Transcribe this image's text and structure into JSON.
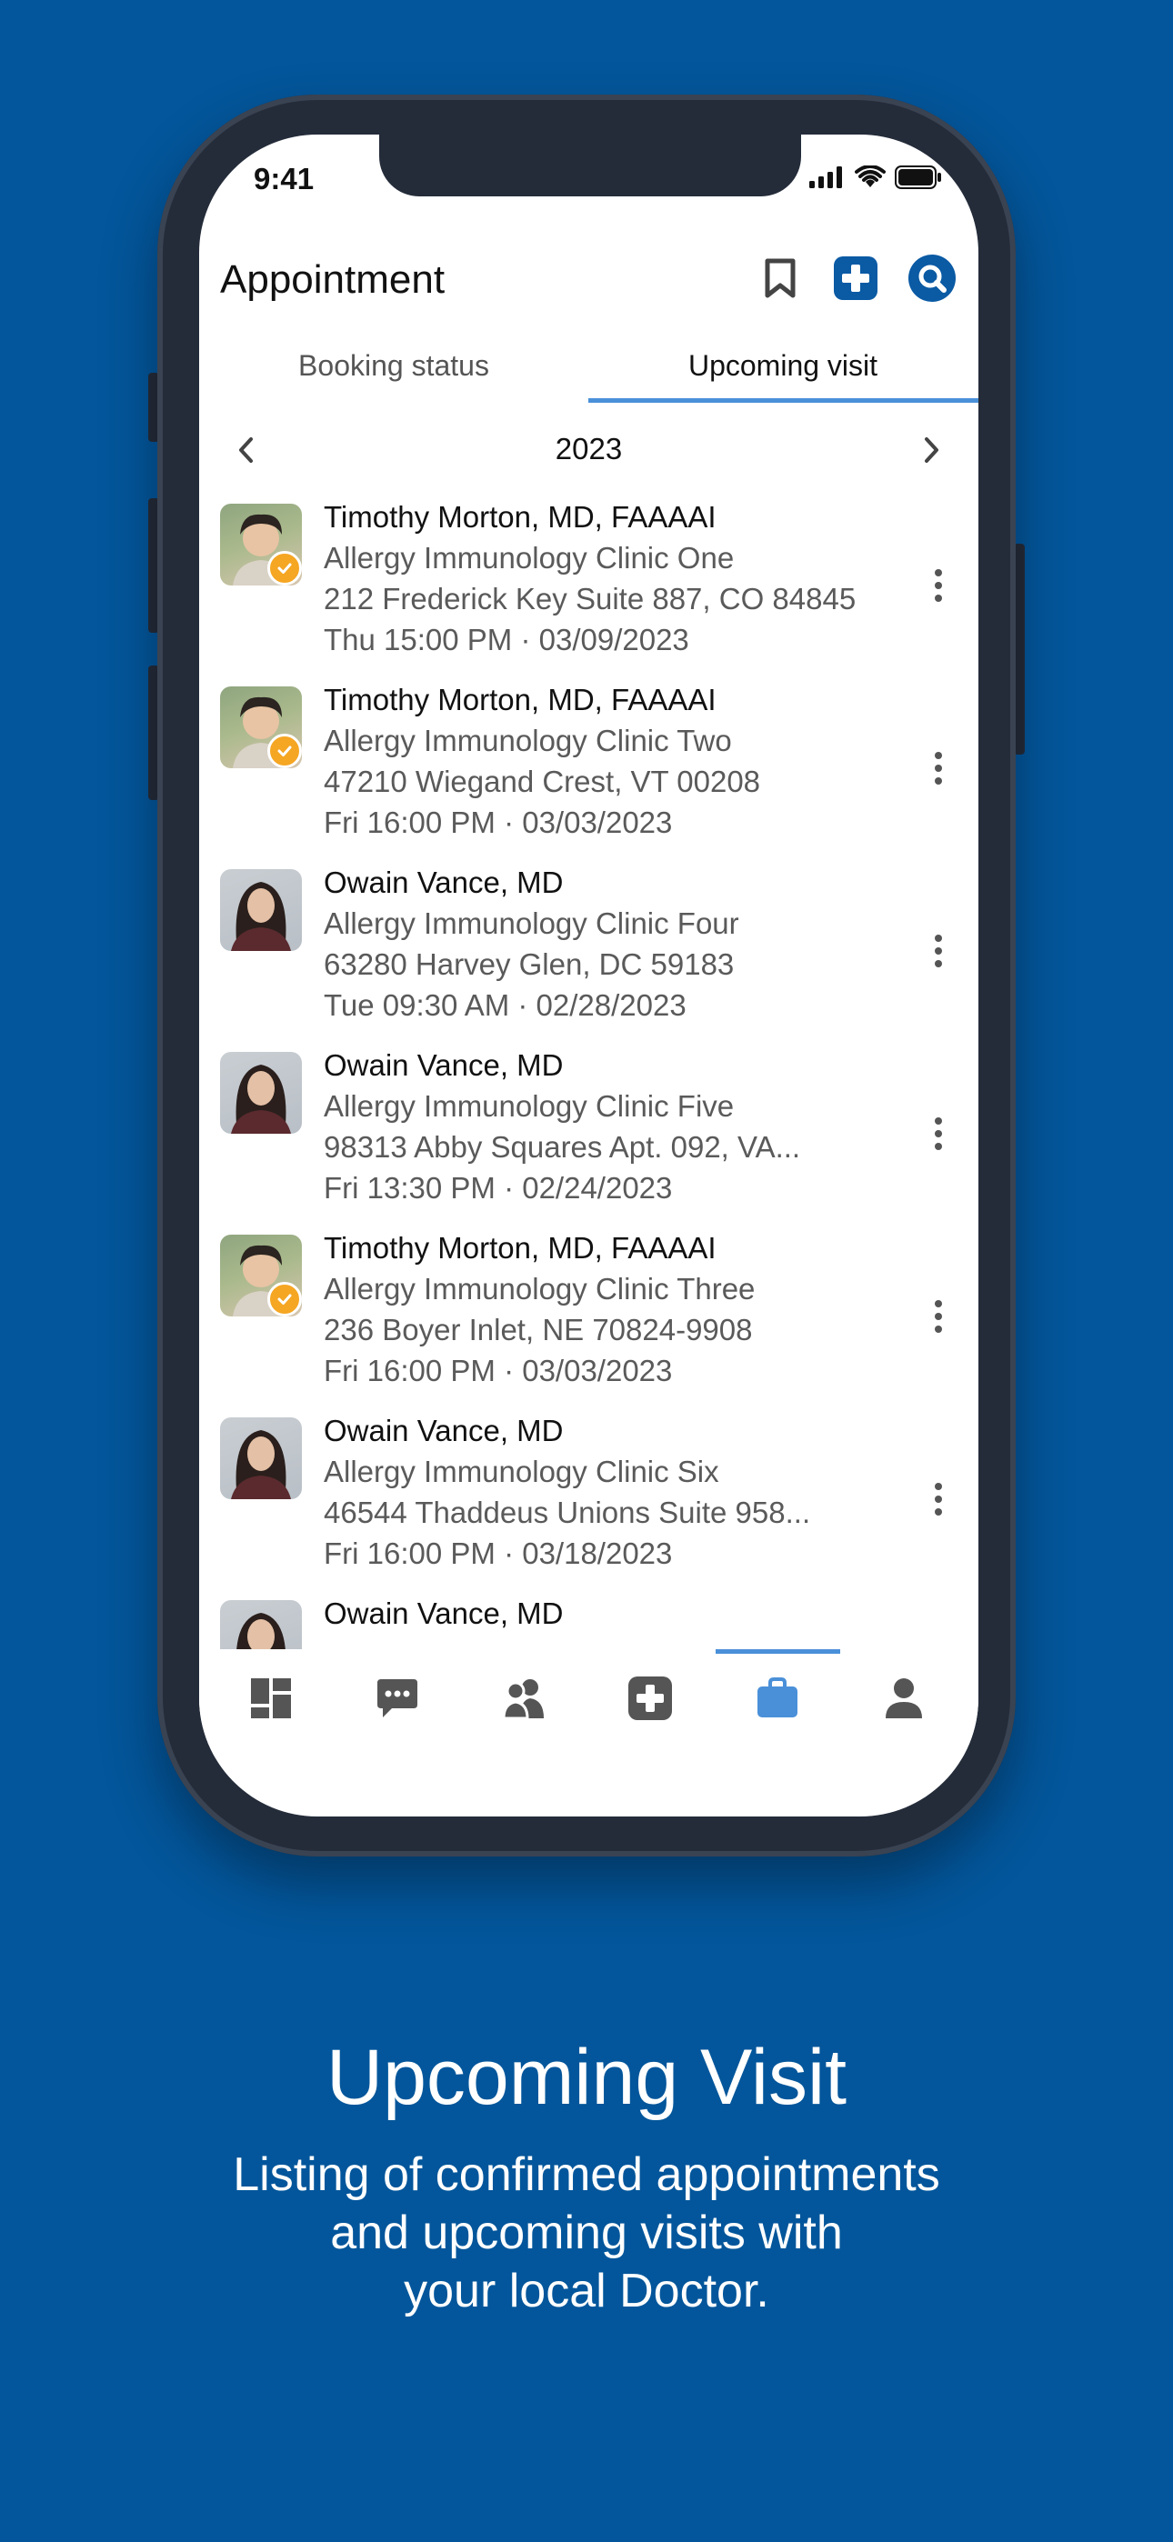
{
  "status_bar": {
    "time": "9:41"
  },
  "header": {
    "title": "Appointment"
  },
  "tabs": [
    {
      "label": "Booking status",
      "active": false
    },
    {
      "label": "Upcoming visit",
      "active": true
    }
  ],
  "year_nav": {
    "year": "2023"
  },
  "appointments": [
    {
      "doctor": "Timothy Morton, MD, FAAAAI",
      "clinic": "Allergy Immunology Clinic One",
      "address": "212 Frederick Key Suite 887, CO 84845",
      "datetime": "Thu 15:00 PM · 03/09/2023",
      "avatar": "male",
      "verified": true
    },
    {
      "doctor": "Timothy Morton, MD, FAAAAI",
      "clinic": "Allergy Immunology Clinic Two",
      "address": "47210 Wiegand Crest, VT 00208",
      "datetime": "Fri 16:00 PM · 03/03/2023",
      "avatar": "male",
      "verified": true
    },
    {
      "doctor": "Owain Vance, MD",
      "clinic": "Allergy Immunology Clinic Four",
      "address": "63280 Harvey Glen, DC 59183",
      "datetime": "Tue 09:30 AM · 02/28/2023",
      "avatar": "female",
      "verified": false
    },
    {
      "doctor": "Owain Vance, MD",
      "clinic": "Allergy Immunology Clinic Five",
      "address": "98313 Abby Squares Apt. 092, VA...",
      "datetime": "Fri 13:30 PM · 02/24/2023",
      "avatar": "female",
      "verified": false
    },
    {
      "doctor": "Timothy Morton, MD, FAAAAI",
      "clinic": "Allergy Immunology Clinic Three",
      "address": "236 Boyer Inlet, NE 70824-9908",
      "datetime": "Fri 16:00 PM · 03/03/2023",
      "avatar": "male",
      "verified": true
    },
    {
      "doctor": "Owain Vance, MD",
      "clinic": "Allergy Immunology Clinic Six",
      "address": "46544 Thaddeus Unions Suite 958...",
      "datetime": "Fri 16:00 PM · 03/18/2023",
      "avatar": "female",
      "verified": false
    },
    {
      "doctor": "Owain Vance, MD",
      "clinic": "",
      "address": "",
      "datetime": "",
      "avatar": "female",
      "verified": false
    }
  ],
  "bottom_nav": [
    {
      "icon": "dashboard-icon",
      "active": false
    },
    {
      "icon": "chat-icon",
      "active": false
    },
    {
      "icon": "users-icon",
      "active": false
    },
    {
      "icon": "medical-plus-icon",
      "active": false
    },
    {
      "icon": "briefcase-icon",
      "active": true
    },
    {
      "icon": "profile-icon",
      "active": false
    }
  ],
  "caption": {
    "title": "Upcoming Visit",
    "line1": "Listing of confirmed appointments",
    "line2": "and upcoming visits with",
    "line3": "your local Doctor."
  },
  "colors": {
    "background": "#03569b",
    "accent": "#4a90d9",
    "header_icon": "#0a5aa4",
    "verified_badge": "#f5a623"
  }
}
